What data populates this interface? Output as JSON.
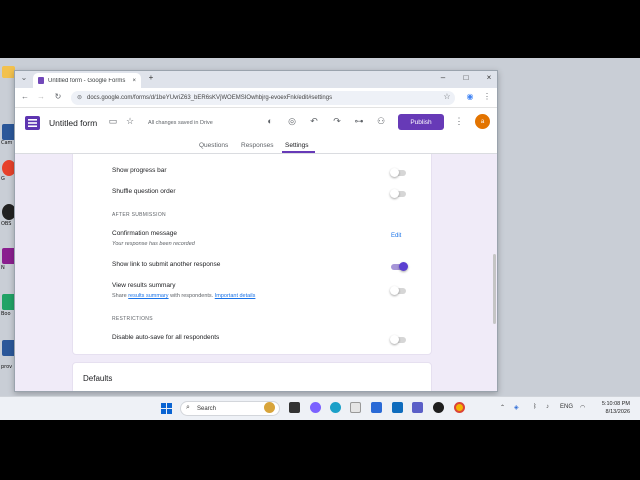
{
  "desktop": {
    "icons": [
      {
        "label": "Cam",
        "color": "#2b579a"
      },
      {
        "label": "G",
        "color": "#e7412b"
      },
      {
        "label": "OBS",
        "color": "#222222"
      },
      {
        "label": "N",
        "color": "#8a1f8f"
      },
      {
        "label": "Boo",
        "color": "#21a366"
      },
      {
        "label": "prov",
        "color": "#2b579a"
      }
    ]
  },
  "browser": {
    "tab_title": "Untitled form - Google Forms",
    "tab_close": "×",
    "new_tab": "+",
    "url": "docs.google.com/forms/d/1beYUvriZ63_bER6sKVjWOEMSIOwhbjrg-evoexFnk/edit#settings",
    "window_controls": {
      "minimize": "–",
      "maximize": "□",
      "close": "×"
    }
  },
  "forms_header": {
    "title": "Untitled form",
    "saved_status": "All changes saved in Drive",
    "publish_label": "Publish",
    "avatar_initial": "a",
    "tabs": [
      {
        "label": "Questions",
        "active": false
      },
      {
        "label": "Responses",
        "active": false
      },
      {
        "label": "Settings",
        "active": true
      }
    ]
  },
  "settings": {
    "show_progress_bar": {
      "label": "Show progress bar",
      "on": false
    },
    "shuffle_question_order": {
      "label": "Shuffle question order",
      "on": false
    },
    "after_submission_header": "AFTER SUBMISSION",
    "confirmation_message": {
      "label": "Confirmation message",
      "sub": "Your response has been recorded",
      "action": "Edit"
    },
    "show_link_another_response": {
      "label": "Show link to submit another response",
      "on": true
    },
    "view_results_summary": {
      "label": "View results summary",
      "sub_prefix": "Share",
      "sub_link1": "results summary",
      "sub_middle": "with respondents.",
      "sub_link2": "Important details",
      "on": false
    },
    "restrictions_header": "RESTRICTIONS",
    "disable_autosave": {
      "label": "Disable auto-save for all respondents",
      "on": false
    },
    "defaults_heading": "Defaults"
  },
  "taskbar": {
    "search_placeholder": "Search",
    "language": "ENG",
    "time": "5:10:08 PM",
    "date": "8/13/2026"
  },
  "colors": {
    "accent": "#673ab7",
    "toggle_on": "#5b3fd1",
    "link": "#1a73e8"
  }
}
